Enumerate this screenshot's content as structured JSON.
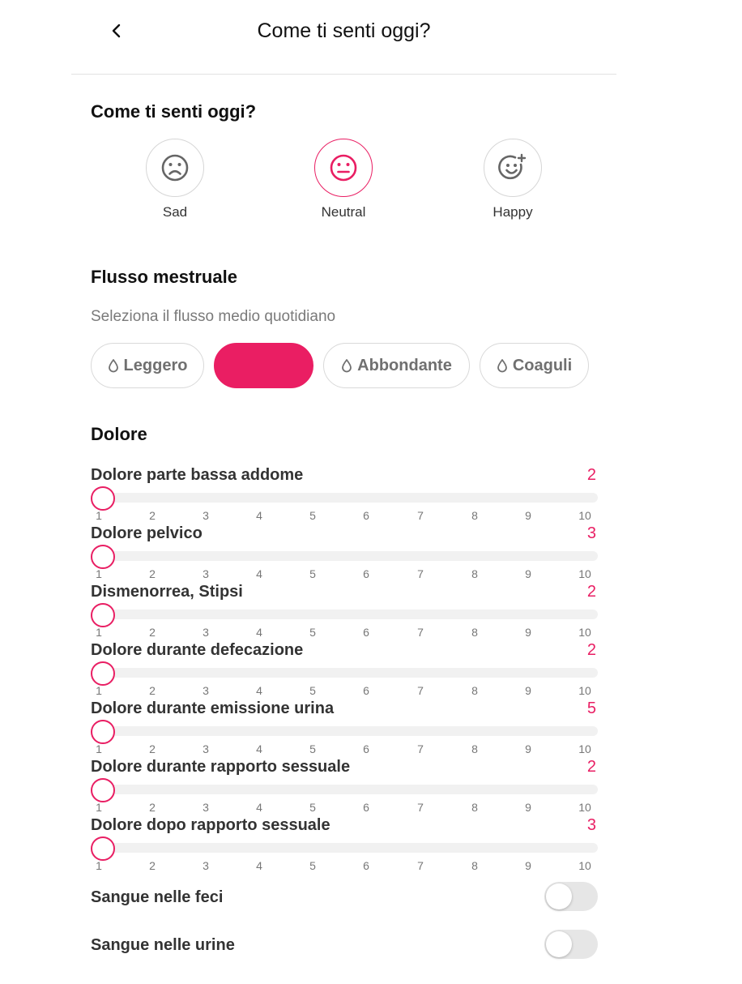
{
  "header": {
    "title": "Come ti senti oggi?"
  },
  "mood": {
    "title": "Come ti senti oggi?",
    "selected": "Neutral",
    "options": [
      {
        "label": "Sad",
        "icon": "sad-face-icon"
      },
      {
        "label": "Neutral",
        "icon": "neutral-face-icon"
      },
      {
        "label": "Happy",
        "icon": "happy-face-plus-icon"
      }
    ]
  },
  "flow": {
    "title": "Flusso mestruale",
    "subtitle": "Seleziona il flusso medio quotidiano",
    "options": [
      {
        "label": "Leggero",
        "icon": "drop-icon",
        "selected": false
      },
      {
        "label": "",
        "icon": "",
        "selected": true
      },
      {
        "label": "Abbondante",
        "icon": "drop-icon",
        "selected": false
      },
      {
        "label": "Coaguli",
        "icon": "drop-icon",
        "selected": false
      }
    ]
  },
  "pain": {
    "title": "Dolore",
    "scale": [
      "1",
      "2",
      "3",
      "4",
      "5",
      "6",
      "7",
      "8",
      "9",
      "10"
    ],
    "items": [
      {
        "label": "Dolore parte bassa addome",
        "value": "2"
      },
      {
        "label": "Dolore pelvico",
        "value": "3"
      },
      {
        "label": "Dismenorrea, Stipsi",
        "value": "2"
      },
      {
        "label": "Dolore durante defecazione",
        "value": "2"
      },
      {
        "label": "Dolore durante emissione urina",
        "value": "5"
      },
      {
        "label": "Dolore durante rapporto sessuale",
        "value": "2"
      },
      {
        "label": "Dolore dopo rapporto sessuale",
        "value": "3"
      }
    ]
  },
  "toggles": [
    {
      "label": "Sangue nelle feci",
      "on": false
    },
    {
      "label": "Sangue nelle urine",
      "on": false
    }
  ],
  "colors": {
    "accent": "#e91e63",
    "track": "#f1f1f1",
    "toggle_off": "#e6e6e6"
  }
}
